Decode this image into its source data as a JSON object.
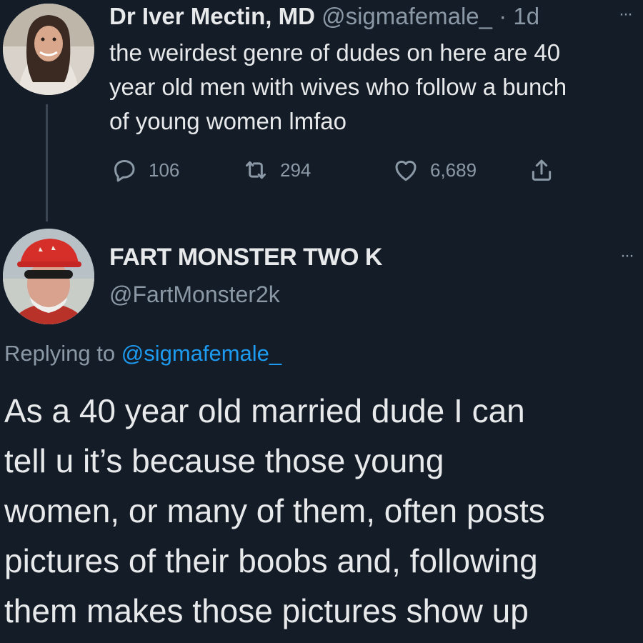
{
  "tweet1": {
    "author_name": "Dr Iver Mectin, MD",
    "author_handle": "@sigmafemale_",
    "separator": "·",
    "time": "1d",
    "more": "···",
    "text_lines": [
      "the weirdest genre of dudes on here are 40",
      "year old men with wives who follow a bunch",
      "of young women lmfao"
    ],
    "actions": {
      "replies": "106",
      "retweets": "294",
      "likes": "6,689"
    }
  },
  "tweet2": {
    "author_name": "FART MONSTER TWO K",
    "author_handle": "@FartMonster2k",
    "more": "···",
    "replying_prefix": "Replying to ",
    "replying_to": "@sigmafemale_",
    "text_lines": [
      "As a 40 year old married dude I can",
      "tell u it’s because those young",
      "women, or many of them, often posts",
      "pictures of their boobs and, following",
      "them makes those pictures show up"
    ]
  },
  "colors": {
    "background": "#141c28",
    "text": "#e7e9ea",
    "muted": "#8b98a5",
    "link": "#1d9bf0"
  },
  "icons": {
    "reply": "speech-bubble-icon",
    "retweet": "retweet-arrows-icon",
    "like": "heart-icon",
    "share": "share-upload-icon",
    "more": "ellipsis-icon"
  }
}
